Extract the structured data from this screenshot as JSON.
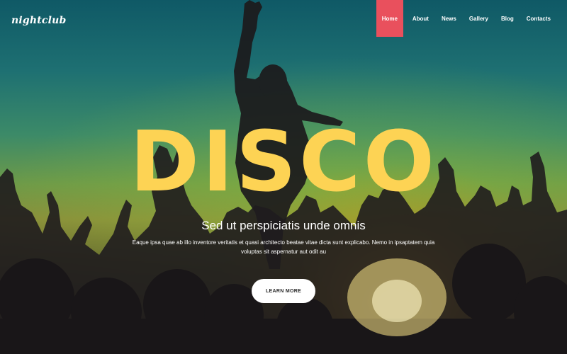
{
  "logo": "nightclub",
  "nav": {
    "items": [
      {
        "label": "Home",
        "active": true
      },
      {
        "label": "About"
      },
      {
        "label": "News"
      },
      {
        "label": "Gallery"
      },
      {
        "label": "Blog"
      },
      {
        "label": "Contacts"
      }
    ]
  },
  "hero": {
    "title": "DISCO",
    "subtitle": "Sed ut perspiciatis unde omnis",
    "description": "Eaque ipsa quae ab illo inventore veritatis et quasi architecto beatae vitae dicta sunt explicabo. Nemo in ipsaptatem quia voluptas sit aspernatur aut odit au",
    "cta_label": "LEARN MORE"
  },
  "colors": {
    "accent": "#e9505d",
    "title": "#fdd354",
    "text": "#ffffff",
    "button_bg": "#ffffff"
  }
}
